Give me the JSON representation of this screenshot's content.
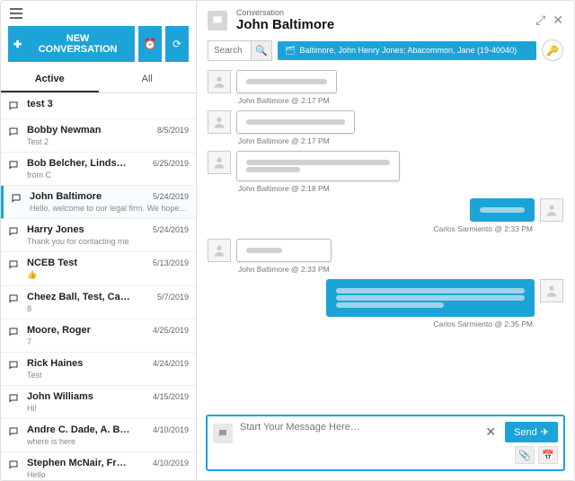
{
  "sidebar": {
    "newConversation": "NEW CONVERSATION",
    "tabs": {
      "active": "Active",
      "all": "All"
    },
    "items": [
      {
        "name": "test 3",
        "date": "",
        "preview": ""
      },
      {
        "name": "Bobby Newman",
        "date": "8/5/2019",
        "preview": "Test 2"
      },
      {
        "name": "Bob Belcher, Lindsy Lohan",
        "date": "6/25/2019",
        "preview": "from C"
      },
      {
        "name": "John Baltimore",
        "date": "5/24/2019",
        "preview": "Hello, welcome to our legal firm. We hope yo…"
      },
      {
        "name": "Harry Jones",
        "date": "5/24/2019",
        "preview": "Thank you for contacting me"
      },
      {
        "name": "NCEB Test",
        "date": "5/13/2019",
        "preview": "👍"
      },
      {
        "name": "Cheez Ball, Test, Carlos …",
        "date": "5/7/2019",
        "preview": "8"
      },
      {
        "name": "Moore, Roger",
        "date": "4/25/2019",
        "preview": "7"
      },
      {
        "name": "Rick Haines",
        "date": "4/24/2019",
        "preview": "Test"
      },
      {
        "name": "John Williams",
        "date": "4/15/2019",
        "preview": "Hi!"
      },
      {
        "name": "Andre C. Dade, A. Bald H…",
        "date": "4/10/2019",
        "preview": "where is here"
      },
      {
        "name": "Stephen McNair, Francis …",
        "date": "4/10/2019",
        "preview": "Hello"
      }
    ]
  },
  "header": {
    "label": "Conversation",
    "name": "John Baltimore"
  },
  "searchPlaceholder": "Search",
  "caseBadge": "Baltimore, John Henry Jones; Abacommon, Jane (19-40040)",
  "messages": [
    {
      "dir": "in",
      "meta": "John Baltimore @ 2:17 PM",
      "lines": [
        90
      ]
    },
    {
      "dir": "in",
      "meta": "John Baltimore @ 2:17 PM",
      "lines": [
        110
      ]
    },
    {
      "dir": "in",
      "meta": "John Baltimore @ 2:18 PM",
      "lines": [
        160,
        60
      ]
    },
    {
      "dir": "out",
      "meta": "Carlos Sarmiento @ 2:33 PM",
      "lines": [
        50
      ]
    },
    {
      "dir": "in",
      "meta": "John Baltimore @ 2:33 PM",
      "lines": [
        40
      ]
    },
    {
      "dir": "out",
      "meta": "Carlos Sarmiento @ 2:35 PM",
      "lines": [
        210,
        210,
        120
      ]
    }
  ],
  "compose": {
    "placeholder": "Start Your Message Here…",
    "send": "Send"
  }
}
